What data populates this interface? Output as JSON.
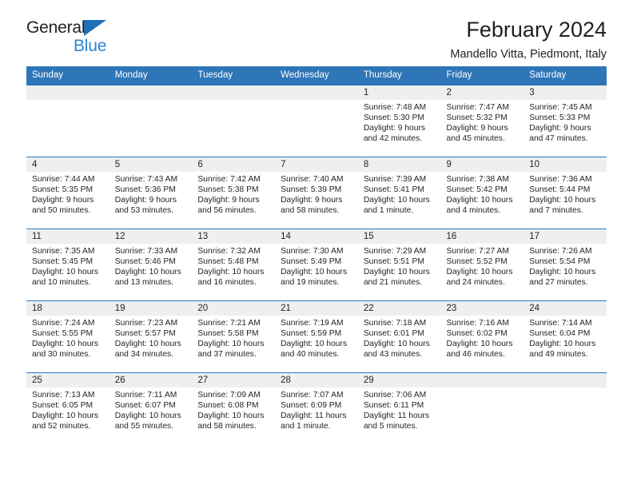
{
  "brand": {
    "name_dark": "General",
    "name_blue": "Blue",
    "accent_blue": "#2e76b8",
    "logo_blue": "#2a86d6"
  },
  "header": {
    "title": "February 2024",
    "subtitle": "Mandello Vitta, Piedmont, Italy"
  },
  "weekday_headers": [
    "Sunday",
    "Monday",
    "Tuesday",
    "Wednesday",
    "Thursday",
    "Friday",
    "Saturday"
  ],
  "weeks": [
    [
      {
        "day": "",
        "lines": []
      },
      {
        "day": "",
        "lines": []
      },
      {
        "day": "",
        "lines": []
      },
      {
        "day": "",
        "lines": []
      },
      {
        "day": "1",
        "lines": [
          "Sunrise: 7:48 AM",
          "Sunset: 5:30 PM",
          "Daylight: 9 hours",
          "and 42 minutes."
        ]
      },
      {
        "day": "2",
        "lines": [
          "Sunrise: 7:47 AM",
          "Sunset: 5:32 PM",
          "Daylight: 9 hours",
          "and 45 minutes."
        ]
      },
      {
        "day": "3",
        "lines": [
          "Sunrise: 7:45 AM",
          "Sunset: 5:33 PM",
          "Daylight: 9 hours",
          "and 47 minutes."
        ]
      }
    ],
    [
      {
        "day": "4",
        "lines": [
          "Sunrise: 7:44 AM",
          "Sunset: 5:35 PM",
          "Daylight: 9 hours",
          "and 50 minutes."
        ]
      },
      {
        "day": "5",
        "lines": [
          "Sunrise: 7:43 AM",
          "Sunset: 5:36 PM",
          "Daylight: 9 hours",
          "and 53 minutes."
        ]
      },
      {
        "day": "6",
        "lines": [
          "Sunrise: 7:42 AM",
          "Sunset: 5:38 PM",
          "Daylight: 9 hours",
          "and 56 minutes."
        ]
      },
      {
        "day": "7",
        "lines": [
          "Sunrise: 7:40 AM",
          "Sunset: 5:39 PM",
          "Daylight: 9 hours",
          "and 58 minutes."
        ]
      },
      {
        "day": "8",
        "lines": [
          "Sunrise: 7:39 AM",
          "Sunset: 5:41 PM",
          "Daylight: 10 hours",
          "and 1 minute."
        ]
      },
      {
        "day": "9",
        "lines": [
          "Sunrise: 7:38 AM",
          "Sunset: 5:42 PM",
          "Daylight: 10 hours",
          "and 4 minutes."
        ]
      },
      {
        "day": "10",
        "lines": [
          "Sunrise: 7:36 AM",
          "Sunset: 5:44 PM",
          "Daylight: 10 hours",
          "and 7 minutes."
        ]
      }
    ],
    [
      {
        "day": "11",
        "lines": [
          "Sunrise: 7:35 AM",
          "Sunset: 5:45 PM",
          "Daylight: 10 hours",
          "and 10 minutes."
        ]
      },
      {
        "day": "12",
        "lines": [
          "Sunrise: 7:33 AM",
          "Sunset: 5:46 PM",
          "Daylight: 10 hours",
          "and 13 minutes."
        ]
      },
      {
        "day": "13",
        "lines": [
          "Sunrise: 7:32 AM",
          "Sunset: 5:48 PM",
          "Daylight: 10 hours",
          "and 16 minutes."
        ]
      },
      {
        "day": "14",
        "lines": [
          "Sunrise: 7:30 AM",
          "Sunset: 5:49 PM",
          "Daylight: 10 hours",
          "and 19 minutes."
        ]
      },
      {
        "day": "15",
        "lines": [
          "Sunrise: 7:29 AM",
          "Sunset: 5:51 PM",
          "Daylight: 10 hours",
          "and 21 minutes."
        ]
      },
      {
        "day": "16",
        "lines": [
          "Sunrise: 7:27 AM",
          "Sunset: 5:52 PM",
          "Daylight: 10 hours",
          "and 24 minutes."
        ]
      },
      {
        "day": "17",
        "lines": [
          "Sunrise: 7:26 AM",
          "Sunset: 5:54 PM",
          "Daylight: 10 hours",
          "and 27 minutes."
        ]
      }
    ],
    [
      {
        "day": "18",
        "lines": [
          "Sunrise: 7:24 AM",
          "Sunset: 5:55 PM",
          "Daylight: 10 hours",
          "and 30 minutes."
        ]
      },
      {
        "day": "19",
        "lines": [
          "Sunrise: 7:23 AM",
          "Sunset: 5:57 PM",
          "Daylight: 10 hours",
          "and 34 minutes."
        ]
      },
      {
        "day": "20",
        "lines": [
          "Sunrise: 7:21 AM",
          "Sunset: 5:58 PM",
          "Daylight: 10 hours",
          "and 37 minutes."
        ]
      },
      {
        "day": "21",
        "lines": [
          "Sunrise: 7:19 AM",
          "Sunset: 5:59 PM",
          "Daylight: 10 hours",
          "and 40 minutes."
        ]
      },
      {
        "day": "22",
        "lines": [
          "Sunrise: 7:18 AM",
          "Sunset: 6:01 PM",
          "Daylight: 10 hours",
          "and 43 minutes."
        ]
      },
      {
        "day": "23",
        "lines": [
          "Sunrise: 7:16 AM",
          "Sunset: 6:02 PM",
          "Daylight: 10 hours",
          "and 46 minutes."
        ]
      },
      {
        "day": "24",
        "lines": [
          "Sunrise: 7:14 AM",
          "Sunset: 6:04 PM",
          "Daylight: 10 hours",
          "and 49 minutes."
        ]
      }
    ],
    [
      {
        "day": "25",
        "lines": [
          "Sunrise: 7:13 AM",
          "Sunset: 6:05 PM",
          "Daylight: 10 hours",
          "and 52 minutes."
        ]
      },
      {
        "day": "26",
        "lines": [
          "Sunrise: 7:11 AM",
          "Sunset: 6:07 PM",
          "Daylight: 10 hours",
          "and 55 minutes."
        ]
      },
      {
        "day": "27",
        "lines": [
          "Sunrise: 7:09 AM",
          "Sunset: 6:08 PM",
          "Daylight: 10 hours",
          "and 58 minutes."
        ]
      },
      {
        "day": "28",
        "lines": [
          "Sunrise: 7:07 AM",
          "Sunset: 6:09 PM",
          "Daylight: 11 hours",
          "and 1 minute."
        ]
      },
      {
        "day": "29",
        "lines": [
          "Sunrise: 7:06 AM",
          "Sunset: 6:11 PM",
          "Daylight: 11 hours",
          "and 5 minutes."
        ]
      },
      {
        "day": "",
        "lines": []
      },
      {
        "day": "",
        "lines": []
      }
    ]
  ]
}
